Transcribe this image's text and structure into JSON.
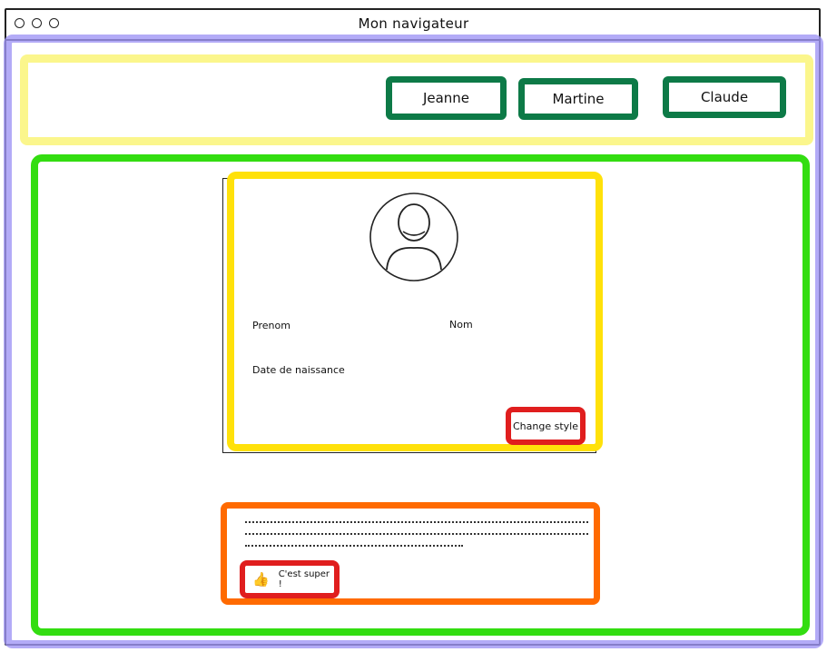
{
  "window": {
    "title": "Mon navigateur"
  },
  "header": {
    "tabs": [
      {
        "label": "Jeanne"
      },
      {
        "label": "Martine"
      },
      {
        "label": "Claude"
      }
    ]
  },
  "profile": {
    "avatar_icon": "user-avatar-icon",
    "fields": {
      "prenom_label": "Prenom",
      "nom_label": "Nom",
      "date_label": "Date de naissance"
    },
    "change_style_label": "Change style"
  },
  "comment": {
    "like_icon": "thumbs-up-icon",
    "like_label": "C'est super !"
  },
  "highlight_colors": {
    "page": "#a096f5",
    "header": "#faf578",
    "tabs": "#0d7a47",
    "main": "#33dd11",
    "card": "#ffe10a",
    "buttons": "#e01e1e",
    "comment": "#ff6a00"
  }
}
